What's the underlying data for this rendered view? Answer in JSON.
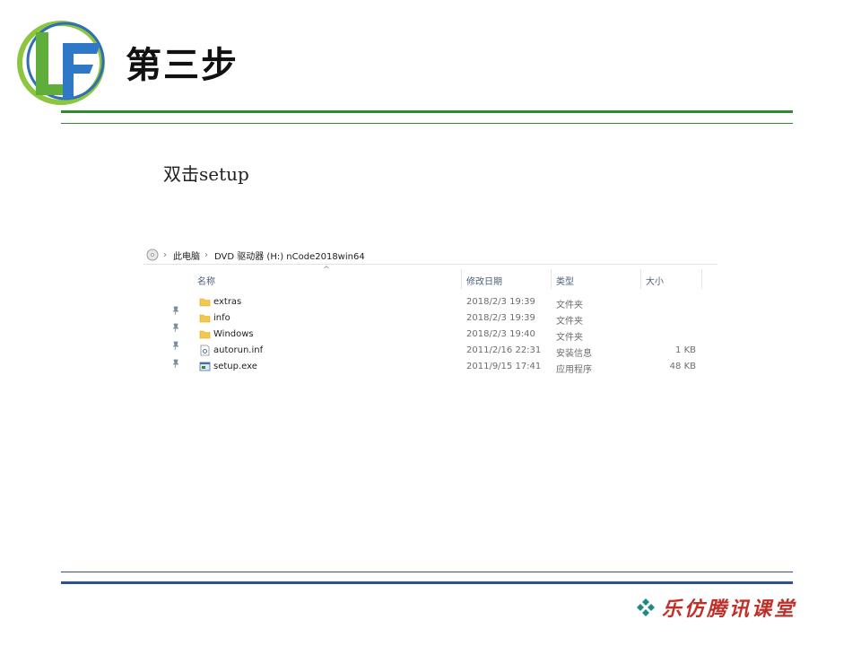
{
  "slide": {
    "title": "第三步",
    "instruction": "双击setup"
  },
  "explorer": {
    "breadcrumb": [
      "此电脑",
      "DVD 驱动器 (H:) nCode2018win64"
    ],
    "columns": {
      "name": "名称",
      "modified": "修改日期",
      "type": "类型",
      "size": "大小"
    },
    "files": [
      {
        "name": "extras",
        "modified": "2018/2/3 19:39",
        "type": "文件夹",
        "size": "",
        "icon": "folder-icon"
      },
      {
        "name": "info",
        "modified": "2018/2/3 19:39",
        "type": "文件夹",
        "size": "",
        "icon": "folder-icon"
      },
      {
        "name": "Windows",
        "modified": "2018/2/3 19:40",
        "type": "文件夹",
        "size": "",
        "icon": "folder-icon"
      },
      {
        "name": "autorun.inf",
        "modified": "2011/2/16 22:31",
        "type": "安装信息",
        "size": "1 KB",
        "icon": "settings-file-icon"
      },
      {
        "name": "setup.exe",
        "modified": "2011/9/15 17:41",
        "type": "应用程序",
        "size": "48 KB",
        "icon": "application-icon"
      }
    ]
  },
  "footer": {
    "brand": "乐仿腾讯课堂"
  },
  "colors": {
    "rule_green": "#2e8b2e",
    "rule_blue": "#2f4f8f",
    "brand_red": "#c0302a",
    "folder_yellow": "#f2c94c"
  }
}
